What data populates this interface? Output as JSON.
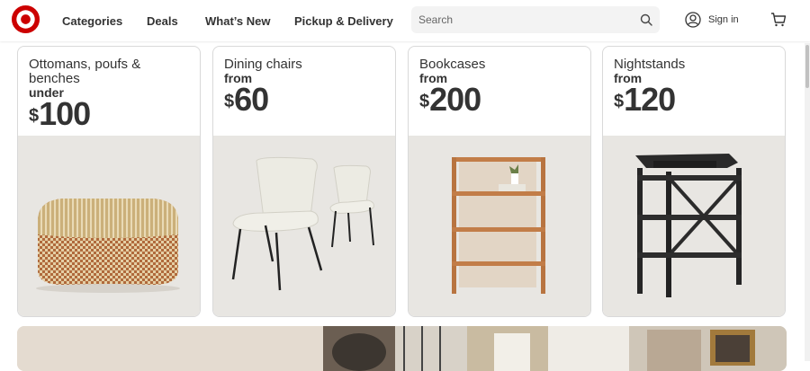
{
  "header": {
    "logo": "target-bullseye-logo",
    "nav": [
      {
        "label": "Categories"
      },
      {
        "label": "Deals"
      },
      {
        "label": "What’s New"
      },
      {
        "label": "Pickup & Delivery"
      }
    ],
    "search": {
      "placeholder": "Search",
      "value": ""
    },
    "signin_label": "Sign in"
  },
  "colors": {
    "brand": "#cc0000",
    "card_bg": "#e8e6e2",
    "text": "#333333"
  },
  "cards": [
    {
      "title": "Ottomans, poufs & benches",
      "qualifier": "under",
      "dollar": "$",
      "price": "100",
      "image": "woven-ottoman"
    },
    {
      "title": "Dining chairs",
      "qualifier": "from",
      "dollar": "$",
      "price": "60",
      "image": "cream-dining-chairs"
    },
    {
      "title": "Bookcases",
      "qualifier": "from",
      "dollar": "$",
      "price": "200",
      "image": "wood-bookcase"
    },
    {
      "title": "Nightstands",
      "qualifier": "from",
      "dollar": "$",
      "price": "120",
      "image": "black-nightstand"
    }
  ]
}
